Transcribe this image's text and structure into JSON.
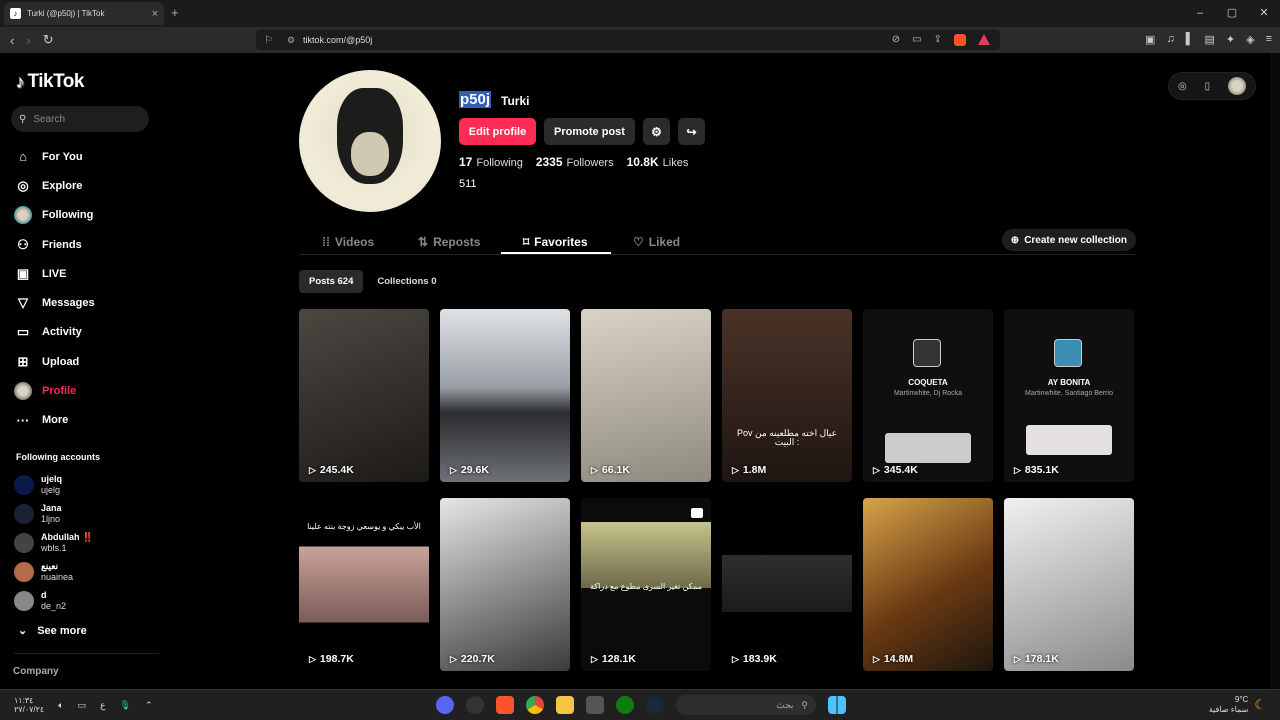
{
  "browser": {
    "tab_title": "Turki (@p50j) | TikTok",
    "url": "tiktok.com/@p50j"
  },
  "sidebar": {
    "brand": "TikTok",
    "search_placeholder": "Search",
    "items": [
      {
        "label": "For You",
        "icon": "home-icon"
      },
      {
        "label": "Explore",
        "icon": "compass-icon"
      },
      {
        "label": "Following",
        "icon": "following-avatar-icon"
      },
      {
        "label": "Friends",
        "icon": "friends-icon"
      },
      {
        "label": "LIVE",
        "icon": "live-icon"
      },
      {
        "label": "Messages",
        "icon": "messages-icon"
      },
      {
        "label": "Activity",
        "icon": "activity-icon"
      },
      {
        "label": "Upload",
        "icon": "upload-icon"
      },
      {
        "label": "Profile",
        "icon": "profile-avatar-icon"
      },
      {
        "label": "More",
        "icon": "more-icon"
      }
    ],
    "following_heading": "Following accounts",
    "following_accounts": [
      {
        "name": "ujelq",
        "username": "ujelg"
      },
      {
        "name": "Jana",
        "username": "1ljno"
      },
      {
        "name": "Abdullah ‼️",
        "username": "wbls.1"
      },
      {
        "name": "نعينع",
        "username": "nuainea"
      },
      {
        "name": "d",
        "username": "de_n2"
      }
    ],
    "see_more": "See more",
    "company": "Company"
  },
  "profile": {
    "username": "p50j",
    "nickname": "Turki",
    "edit_profile": "Edit profile",
    "promote_post": "Promote post",
    "following_count": "17",
    "following_label": "Following",
    "followers_count": "2335",
    "followers_label": "Followers",
    "likes_count": "10.8K",
    "likes_label": "Likes",
    "bio": "511"
  },
  "tabs": [
    {
      "label": "Videos"
    },
    {
      "label": "Reposts"
    },
    {
      "label": "Favorites"
    },
    {
      "label": "Liked"
    }
  ],
  "create_collection": "Create new collection",
  "subtabs": {
    "posts": "Posts 624",
    "collections": "Collections 0"
  },
  "videos": [
    {
      "views": "245.4K",
      "bg": "#3a3530"
    },
    {
      "views": "29.6K",
      "bg": "#8a8e93"
    },
    {
      "views": "66.1K",
      "bg": "#b2ab9c"
    },
    {
      "views": "1.8M",
      "bg": "#2a1f1b",
      "caption": "Pov\nعيال اخته مطلعينه من البيت :"
    },
    {
      "views": "345.4K",
      "bg": "#101010",
      "song": "COQUETA",
      "artist": "Martinwhite, Dj Rocka"
    },
    {
      "views": "835.1K",
      "bg": "#101010",
      "song": "AY BONITA",
      "artist": "Martinwhite, Santiago Berrio"
    },
    {
      "views": "198.7K",
      "bg": "#0b0b0b",
      "caption": "الأب يبكي و يوسعي زوجة بنته علينا"
    },
    {
      "views": "220.7K",
      "bg": "#4a4a4a"
    },
    {
      "views": "128.1K",
      "bg": "#1a1c16",
      "caption": "ممكن تغير السرى مطوع مع دراكة"
    },
    {
      "views": "183.9K",
      "bg": "#151515"
    },
    {
      "views": "14.8M",
      "bg": "#5a3a18"
    },
    {
      "views": "178.1K",
      "bg": "#c8c8c8"
    }
  ],
  "taskbar": {
    "time": "١١:٣٤",
    "date": "٢٧/٠٧/٢٤",
    "search_placeholder": "بحث",
    "weather_temp": "9°C",
    "weather_text": "سماء صافية"
  }
}
